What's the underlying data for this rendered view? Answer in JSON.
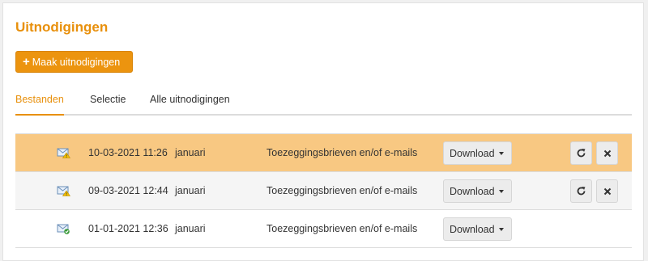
{
  "page": {
    "title": "Uitnodigingen",
    "make_button_label": "Maak uitnodigingen"
  },
  "tabs": [
    {
      "label": "Bestanden",
      "active": true
    },
    {
      "label": "Selectie",
      "active": false
    },
    {
      "label": "Alle uitnodigingen",
      "active": false
    }
  ],
  "rows": [
    {
      "icon": "envelope-warning-icon",
      "date": "10-03-2021 11:26",
      "period": "januari",
      "type": "Toezeggingsbrieven en/of e-mails",
      "download_label": "Download",
      "highlighted": true,
      "has_actions": true
    },
    {
      "icon": "envelope-warning-icon",
      "date": "09-03-2021 12:44",
      "period": "januari",
      "type": "Toezeggingsbrieven en/of e-mails",
      "download_label": "Download",
      "highlighted": false,
      "has_actions": true
    },
    {
      "icon": "envelope-success-icon",
      "date": "01-01-2021 12:36",
      "period": "januari",
      "type": "Toezeggingsbrieven en/of e-mails",
      "download_label": "Download",
      "highlighted": false,
      "has_actions": false
    }
  ],
  "colors": {
    "accent": "#e8900c",
    "highlight_row": "#f8c882"
  }
}
